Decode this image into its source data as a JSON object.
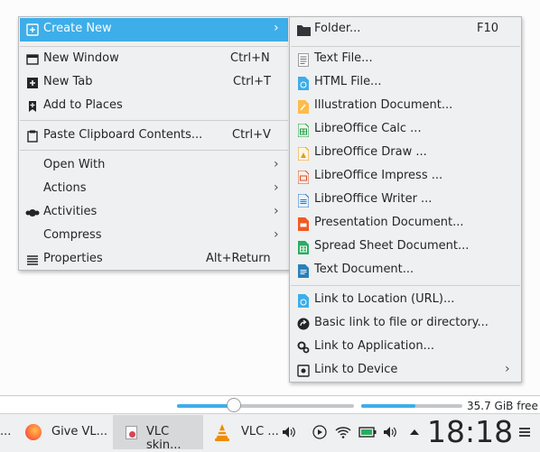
{
  "storage": {
    "free_text": "35.7 GiB free",
    "volume_level": 0.33,
    "usage_level": 0.54
  },
  "main_menu": {
    "items": [
      {
        "label": "Create New",
        "icon": "create-new-icon"
      },
      {
        "label": "New Window",
        "shortcut": "Ctrl+N",
        "icon": "new-window-icon"
      },
      {
        "label": "New Tab",
        "shortcut": "Ctrl+T",
        "icon": "new-tab-icon"
      },
      {
        "label": "Add to Places",
        "icon": "bookmark-icon"
      },
      {
        "label": "Paste Clipboard Contents...",
        "shortcut": "Ctrl+V",
        "icon": "paste-icon"
      },
      {
        "label": "Open With"
      },
      {
        "label": "Actions"
      },
      {
        "label": "Activities",
        "icon": "activities-icon"
      },
      {
        "label": "Compress"
      },
      {
        "label": "Properties",
        "shortcut": "Alt+Return",
        "icon": "properties-icon"
      }
    ]
  },
  "submenu": {
    "items": [
      {
        "label": "Folder...",
        "shortcut": "F10",
        "icon": "folder-icon"
      },
      {
        "label": "Text File...",
        "icon": "text-file-icon"
      },
      {
        "label": "HTML File...",
        "icon": "html-file-icon"
      },
      {
        "label": "Illustration Document...",
        "icon": "illustration-icon"
      },
      {
        "label": "LibreOffice Calc  ...",
        "icon": "calc-icon"
      },
      {
        "label": "LibreOffice Draw  ...",
        "icon": "draw-icon"
      },
      {
        "label": "LibreOffice Impress  ...",
        "icon": "impress-icon"
      },
      {
        "label": "LibreOffice Writer  ...",
        "icon": "writer-icon"
      },
      {
        "label": "Presentation Document...",
        "icon": "presentation-icon"
      },
      {
        "label": "Spread Sheet Document...",
        "icon": "spreadsheet-icon"
      },
      {
        "label": "Text Document...",
        "icon": "text-document-icon"
      },
      {
        "label": "Link to Location (URL)...",
        "icon": "link-url-icon"
      },
      {
        "label": "Basic link to file or directory...",
        "icon": "basic-link-icon"
      },
      {
        "label": "Link to Application...",
        "icon": "application-icon"
      },
      {
        "label": "Link to Device",
        "icon": "device-icon"
      }
    ]
  },
  "taskbar": {
    "tasks": [
      {
        "label": "..."
      },
      {
        "label": "Give VL...",
        "icon": "firefox-icon"
      },
      {
        "label": "VLC skin...",
        "icon": "vlc-skin-icon"
      },
      {
        "label": "VLC ...",
        "icon": "vlc-icon"
      }
    ],
    "clock": "18:18"
  },
  "colors": {
    "accent": "#3daee9",
    "menu_bg": "#eff0f1",
    "text": "#232627"
  }
}
